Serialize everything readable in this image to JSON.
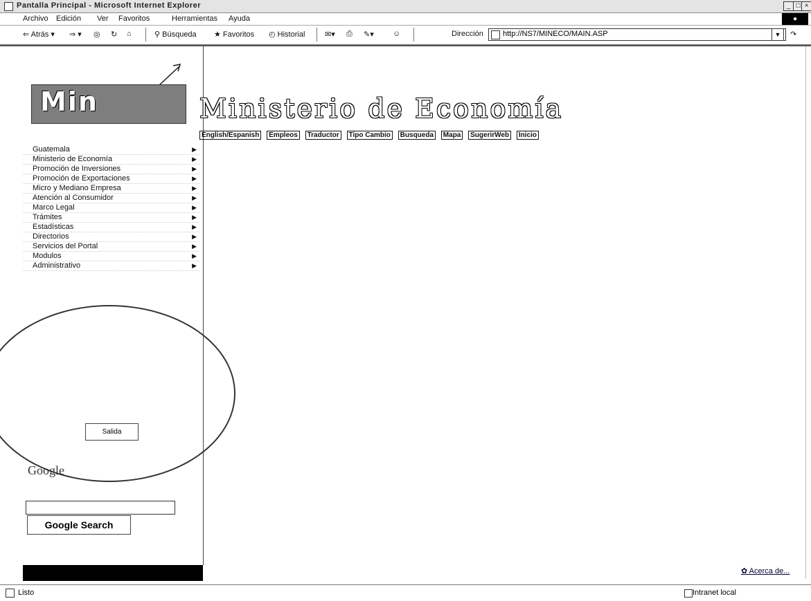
{
  "window": {
    "title": "Pantalla Principal - Microsoft Internet Explorer"
  },
  "menubar": {
    "items": [
      "Archivo",
      "Edición",
      "Ver",
      "Favoritos",
      "Herramientas",
      "Ayuda"
    ]
  },
  "toolbar": {
    "back": "Atrás",
    "search": "Búsqueda",
    "favorites": "Favoritos",
    "history": "Historial",
    "address_label": "Dirección",
    "address_value": "http://NS7/MINECO/MAIN.ASP"
  },
  "site": {
    "logo_text": "Min",
    "title": "Ministerio de Economía",
    "topnav": [
      "English/Espanish",
      "Empleos",
      "Traductor",
      "Tipo Cambio",
      "Busqueda",
      "Mapa",
      "SugerirWeb",
      "Inicio"
    ]
  },
  "nav": {
    "items": [
      "Guatemala",
      "Ministerio de Economía",
      "Promoción de Inversiones",
      "Promoción de Exportaciones",
      "Micro y Mediano Empresa",
      "Atención al Consumidor",
      "Marco Legal",
      "Trámites",
      "Estadísticas",
      "Directorios",
      "Servicios del Portal",
      "Modulos",
      "Administrativo"
    ]
  },
  "salida": "Salida",
  "google": {
    "logo": "Google",
    "button": "Google Search",
    "input_value": ""
  },
  "about": "Acerca de...",
  "status": {
    "text": "Listo",
    "zone": "Intranet local"
  }
}
